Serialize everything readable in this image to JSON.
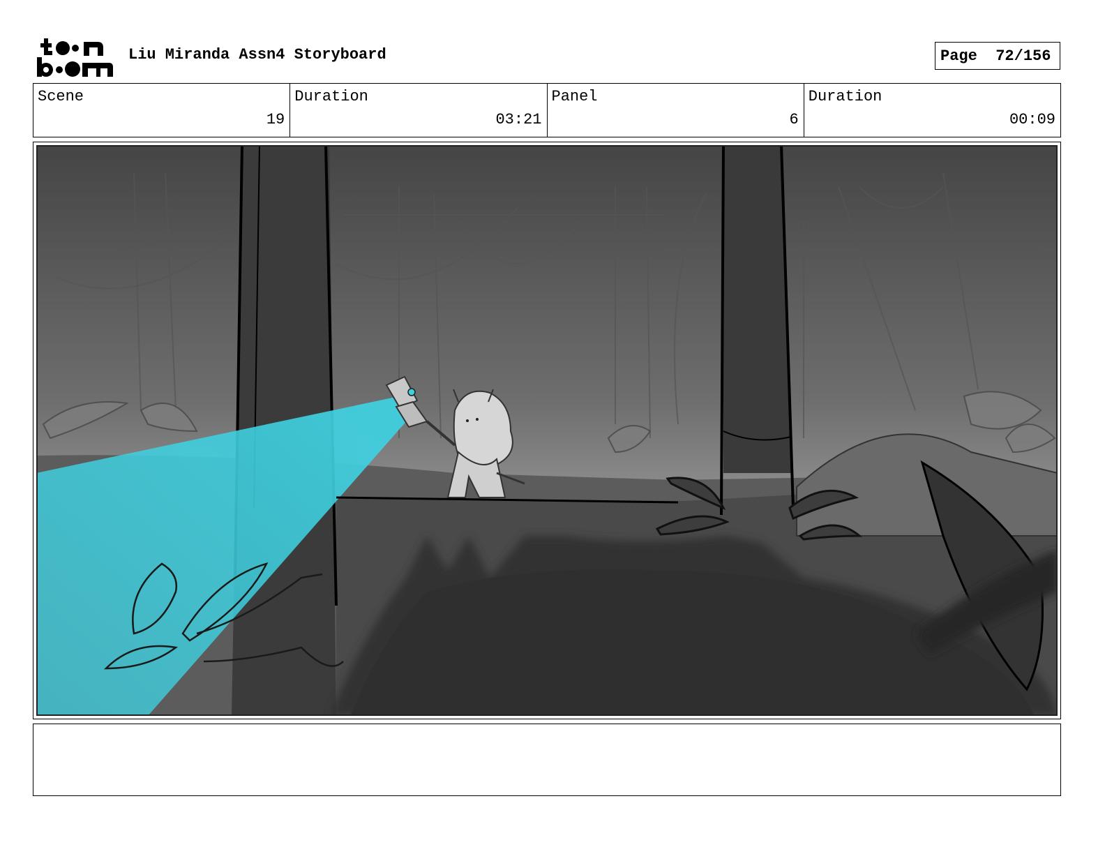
{
  "header": {
    "logo_text": "toonboom",
    "title": "Liu Miranda Assn4 Storyboard",
    "page_label": "Page",
    "page_value": "72/156"
  },
  "info": {
    "scene_label": "Scene",
    "scene_value": "19",
    "scene_duration_label": "Duration",
    "scene_duration_value": "03:21",
    "panel_label": "Panel",
    "panel_value": "6",
    "panel_duration_label": "Duration",
    "panel_duration_value": "00:09"
  },
  "notes": {
    "text": ""
  },
  "colors": {
    "flashlight_beam": "#3fd0e0",
    "sky_dark": "#4a4a4a",
    "ground_dark": "#333333"
  }
}
